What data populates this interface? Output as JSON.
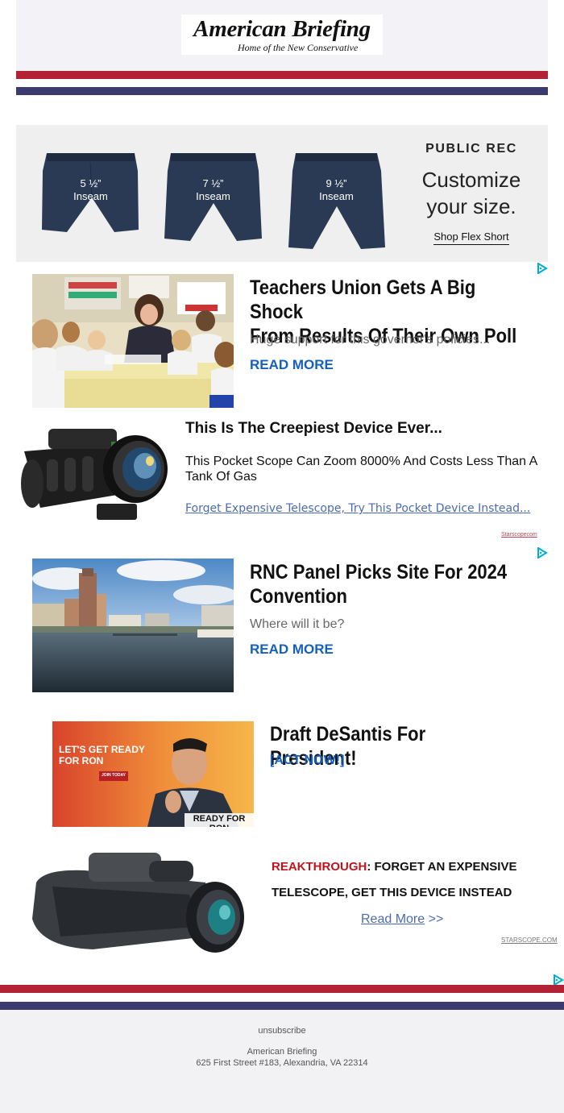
{
  "colors": {
    "flag_red": "#b22234",
    "flag_blue": "#3c3b6e",
    "link_blue": "#1560bd",
    "ad_link": "#4a6bb4",
    "alert_red": "#c0141c"
  },
  "header": {
    "logo_title": "American Briefing",
    "logo_tagline": "Home of the New Conservative"
  },
  "public_rec_ad": {
    "shorts": [
      {
        "size": "5 ½”",
        "label": "Inseam"
      },
      {
        "size": "7 ½”",
        "label": "Inseam"
      },
      {
        "size": "9 ½”",
        "label": "Inseam"
      }
    ],
    "brand": "PUBLIC REC",
    "headline_1": "Customize",
    "headline_2": "your size.",
    "cta": "Shop Flex Short"
  },
  "articles": [
    {
      "title_1": "Teachers Union Gets A Big Shock",
      "title_2": "From Results Of Their Own Poll",
      "subtitle": "Huge support for this governor's policies...",
      "link": "READ MORE",
      "icon": "adchoices-icon"
    },
    {
      "title_1": "RNC Panel Picks Site For 2024",
      "title_2": "Convention",
      "subtitle": "Where will it be?",
      "link": "READ MORE",
      "icon": "adchoices-icon"
    }
  ],
  "scope_ad": {
    "title": "This Is The Creepiest Device Ever...",
    "body": "This Pocket Scope Can Zoom 8000% And Costs Less Than A Tank Of Gas",
    "link": "Forget Expensive Telescope, Try This Pocket Device Instead...",
    "source": "Starscopecom"
  },
  "desantis_ad": {
    "banner_line_1": "LET'S GET READY",
    "banner_line_2": "FOR RON",
    "banner_button": "JOIN TODAY",
    "banner_caption": "READY FOR RON",
    "title": "Draft DeSantis For President!",
    "cta": "[ACT NOW!]"
  },
  "breakthrough_ad": {
    "prefix": "REAKTHROUGH",
    "line_1_rest": ": FORGET AN EXPENSIVE",
    "line_2": "TELESCOPE, GET THIS DEVICE INSTEAD",
    "link": "Read More",
    "link_suffix": " >>",
    "source": "STARSCOPE.COM"
  },
  "footer": {
    "unsubscribe": "unsubscribe",
    "name": "American Briefing",
    "address": "625 First Street #183, Alexandria, VA 22314"
  }
}
